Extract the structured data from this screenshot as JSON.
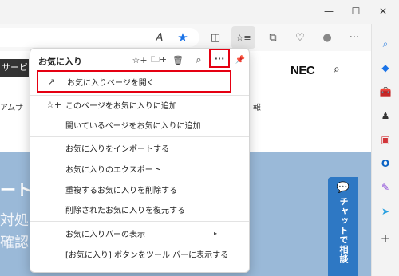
{
  "window": {
    "minimize": "—",
    "maximize": "☐",
    "close": "✕"
  },
  "toolbar": {
    "read_aloud": "A",
    "favorite_star": "★",
    "split": "◫",
    "favorites": "☆≡",
    "collections": "⧉",
    "health": "♡",
    "profile": "●",
    "more": "···",
    "copilot": "✦"
  },
  "site": {
    "nav_dark": "サービス",
    "nav_fragment_1": "アムサ",
    "nav_fragment_2": "報",
    "logo": "NEC",
    "search": "⌕",
    "hero_line_1": "ート",
    "hero_line_2": "対処",
    "hero_line_3": "確認",
    "chat_icon": "💬",
    "chat_label": "チャットで相談"
  },
  "favorites": {
    "title": "お気に入り",
    "header_icons": {
      "add_favorite": "☆+",
      "add_folder": "🗀+",
      "delete": "🗑",
      "search": "⌕",
      "more": "···",
      "pin": "📌"
    },
    "items": [
      {
        "icon": "↗",
        "label": "お気に入りページを開く"
      },
      {
        "icon": "☆+",
        "label": "このページをお気に入りに追加"
      },
      {
        "icon": "",
        "label": "開いているページをお気に入りに追加"
      },
      {
        "icon": "",
        "label": "お気に入りをインポートする"
      },
      {
        "icon": "",
        "label": "お気に入りのエクスポート"
      },
      {
        "icon": "",
        "label": "重複するお気に入りを削除する"
      },
      {
        "icon": "",
        "label": "削除されたお気に入りを復元する"
      },
      {
        "icon": "",
        "label": "お気に入りバーの表示",
        "chevron": "▸"
      },
      {
        "icon": "",
        "label": "[お気に入り] ボタンをツール バーに表示する"
      }
    ]
  },
  "sidebar": {
    "search": "⌕",
    "shopping": "◆",
    "tools": "🧰",
    "games": "♟",
    "office": "▣",
    "outlook": "O",
    "designer": "✎",
    "telegram": "➤",
    "add": "+"
  },
  "colors": {
    "highlight": "#e50012",
    "star_active": "#1a73e8",
    "hero": "#9ab9d8",
    "chat": "#2e78c4"
  }
}
